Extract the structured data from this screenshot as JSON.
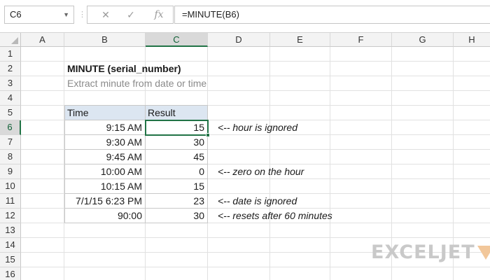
{
  "name_box": {
    "value": "C6"
  },
  "formula_bar": {
    "cancel_glyph": "✕",
    "enter_glyph": "✓",
    "fx_label": "fx",
    "formula": "=MINUTE(B6)"
  },
  "columns": [
    "A",
    "B",
    "C",
    "D",
    "E",
    "F",
    "G",
    "H"
  ],
  "rows": [
    "1",
    "2",
    "3",
    "4",
    "5",
    "6",
    "7",
    "8",
    "9",
    "10",
    "11",
    "12",
    "13",
    "14",
    "15",
    "16"
  ],
  "selected": {
    "column": "C",
    "row": "6"
  },
  "sheet": {
    "title": "MINUTE (serial_number)",
    "subtitle": "Extract minute from date or time"
  },
  "table": {
    "headers": {
      "time": "Time",
      "result": "Result"
    },
    "rows": [
      {
        "time": "9:15 AM",
        "result": "15"
      },
      {
        "time": "9:30 AM",
        "result": "30"
      },
      {
        "time": "9:45 AM",
        "result": "45"
      },
      {
        "time": "10:00 AM",
        "result": "0"
      },
      {
        "time": "10:15 AM",
        "result": "15"
      },
      {
        "time": "7/1/15 6:23 PM",
        "result": "23"
      },
      {
        "time": "90:00",
        "result": "30"
      }
    ]
  },
  "notes": {
    "row6": "<-- hour is ignored",
    "row9": "<-- zero on the hour",
    "row11": "<-- date is ignored",
    "row12": "<-- resets after 60 minutes"
  },
  "logo": {
    "text": "EXCELJET"
  },
  "colors": {
    "accent_green": "#217346",
    "header_fill": "#dce6f1",
    "logo_gray": "#c9c9c9",
    "logo_orange": "#f2c79a"
  }
}
